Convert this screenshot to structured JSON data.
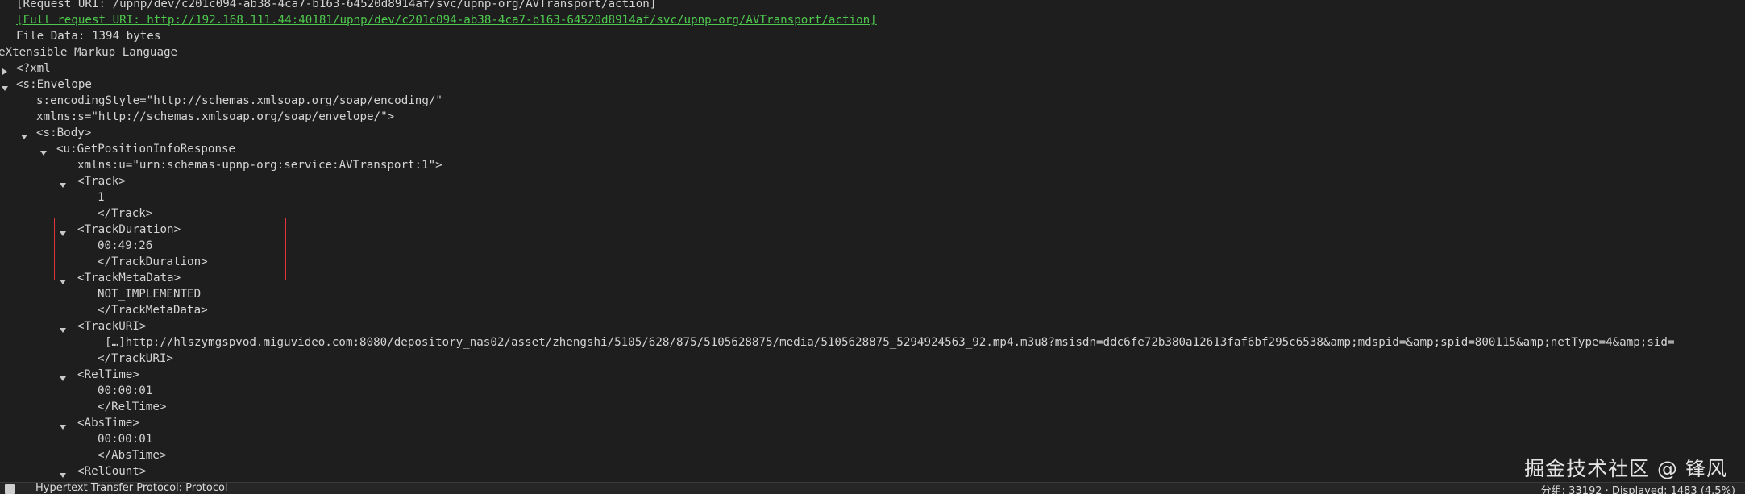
{
  "header": {
    "request_uri": "[Request URI: /upnp/dev/c201c094-ab38-4ca7-b163-64520d8914af/svc/upnp-org/AVTransport/action]",
    "full_request_uri": "[Full request URI: http://192.168.111.44:40181/upnp/dev/c201c094-ab38-4ca7-b163-64520d8914af/svc/upnp-org/AVTransport/action]",
    "file_data": "File Data: 1394 bytes",
    "section_title": "eXtensible Markup Language"
  },
  "xml_tree": {
    "xml_decl": "<?xml",
    "envelope_open": "<s:Envelope",
    "encoding_style": "s:encodingStyle=\"http://schemas.xmlsoap.org/soap/encoding/\"",
    "xmlns_s": "xmlns:s=\"http://schemas.xmlsoap.org/soap/envelope/\">",
    "body_open": "<s:Body>",
    "response_open": "<u:GetPositionInfoResponse",
    "xmlns_u": "xmlns:u=\"urn:schemas-upnp-org:service:AVTransport:1\">",
    "track_open": "<Track>",
    "track_value": "1",
    "track_close": "</Track>",
    "duration_open": "<TrackDuration>",
    "duration_value": "00:49:26",
    "duration_close": "</TrackDuration>",
    "metadata_open": "<TrackMetaData>",
    "metadata_value": "NOT_IMPLEMENTED",
    "metadata_close": "</TrackMetaData>",
    "uri_open": "<TrackURI>",
    "uri_value": "[…]http://hlszymgspvod.miguvideo.com:8080/depository_nas02/asset/zhengshi/5105/628/875/5105628875/media/5105628875_5294924563_92.mp4.m3u8?msisdn=ddc6fe72b380a12613faf6bf295c6538&amp;mdspid=&amp;spid=800115&amp;netType=4&amp;sid=",
    "uri_close": "</TrackURI>",
    "reltime_open": "<RelTime>",
    "reltime_value": "00:00:01",
    "reltime_close": "</RelTime>",
    "abstime_open": "<AbsTime>",
    "abstime_value": "00:00:01",
    "abstime_close": "</AbsTime>",
    "relcount_open": "<RelCount>"
  },
  "watermark": "掘金技术社区 @ 锋风",
  "status_bar": {
    "left_text": "Hypertext Transfer Protocol: Protocol",
    "right_text": "分组: 33192 · Displayed: 1483 (4.5%)"
  },
  "colors": {
    "background": "#1e1e1e",
    "text": "#d4d4d4",
    "link": "#4ec94e",
    "highlight_border": "#e0333a"
  }
}
